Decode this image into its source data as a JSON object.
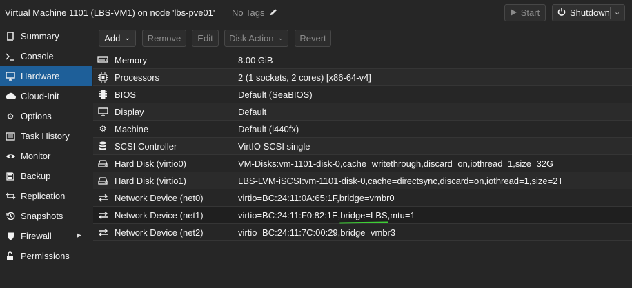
{
  "header": {
    "title": "Virtual Machine 1101 (LBS-VM1) on node 'lbs-pve01'",
    "tags": "No Tags",
    "start_label": "Start",
    "shutdown_label": "Shutdown"
  },
  "sidebar": {
    "items": [
      {
        "label": "Summary",
        "icon": "book-icon"
      },
      {
        "label": "Console",
        "icon": "terminal-icon"
      },
      {
        "label": "Hardware",
        "icon": "monitor-icon",
        "active": true
      },
      {
        "label": "Cloud-Init",
        "icon": "cloud-icon"
      },
      {
        "label": "Options",
        "icon": "gear-icon"
      },
      {
        "label": "Task History",
        "icon": "list-icon"
      },
      {
        "label": "Monitor",
        "icon": "eye-icon"
      },
      {
        "label": "Backup",
        "icon": "floppy-icon"
      },
      {
        "label": "Replication",
        "icon": "retweet-icon"
      },
      {
        "label": "Snapshots",
        "icon": "history-icon"
      },
      {
        "label": "Firewall",
        "icon": "shield-icon"
      },
      {
        "label": "Permissions",
        "icon": "unlock-icon"
      }
    ]
  },
  "toolbar": {
    "add": "Add",
    "remove": "Remove",
    "edit": "Edit",
    "disk_action": "Disk Action",
    "revert": "Revert"
  },
  "hardware": {
    "rows": [
      {
        "name": "Memory",
        "value": "8.00 GiB",
        "icon": "memory-icon"
      },
      {
        "name": "Processors",
        "value": "2 (1 sockets, 2 cores) [x86-64-v4]",
        "icon": "cpu-icon"
      },
      {
        "name": "BIOS",
        "value": "Default (SeaBIOS)",
        "icon": "microchip-icon"
      },
      {
        "name": "Display",
        "value": "Default",
        "icon": "desktop-icon"
      },
      {
        "name": "Machine",
        "value": "Default (i440fx)",
        "icon": "cogs-icon"
      },
      {
        "name": "SCSI Controller",
        "value": "VirtIO SCSI single",
        "icon": "database-icon"
      },
      {
        "name": "Hard Disk (virtio0)",
        "value": "VM-Disks:vm-1101-disk-0,cache=writethrough,discard=on,iothread=1,size=32G",
        "icon": "hdd-icon"
      },
      {
        "name": "Hard Disk (virtio1)",
        "value": "LBS-LVM-iSCSI:vm-1101-disk-0,cache=directsync,discard=on,iothread=1,size=2T",
        "icon": "hdd-icon"
      },
      {
        "name": "Network Device (net0)",
        "value": "virtio=BC:24:11:0A:65:1F,bridge=vmbr0",
        "icon": "exchange-icon"
      },
      {
        "name": "Network Device (net1)",
        "value_prefix": "virtio=BC:24:11:F0:82:1E,",
        "value_mark": "bridge=LBS",
        "value_suffix": ",mtu=1",
        "icon": "exchange-icon"
      },
      {
        "name": "Network Device (net2)",
        "value": "virtio=BC:24:11:7C:00:29,bridge=vmbr3",
        "icon": "exchange-icon"
      }
    ]
  }
}
